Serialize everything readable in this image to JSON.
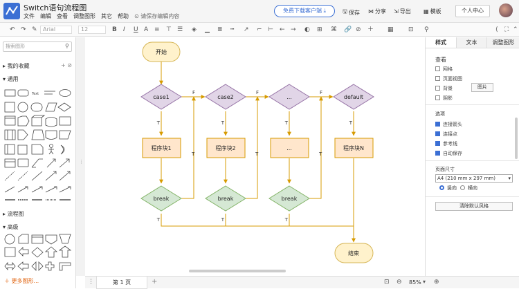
{
  "app": {
    "title": "Switch语句流程图",
    "menu": [
      "文件",
      "编辑",
      "查看",
      "调整图形",
      "其它",
      "帮助"
    ],
    "unsaved_notice": "请保存编辑内容",
    "download_btn": "免费下载客户端",
    "actions": [
      "保存",
      "分享",
      "导出",
      "模板"
    ],
    "personal_center": "个人中心"
  },
  "toolbar": {
    "font_family": "Arial",
    "font_size": "12"
  },
  "left_panel": {
    "search_placeholder": "搜索图形",
    "sections": [
      "我的收藏",
      "通用",
      "流程图",
      "高级"
    ],
    "more_shapes": "更多图形..."
  },
  "right_panel": {
    "tabs": [
      "样式",
      "文本",
      "调整图形"
    ],
    "view_title": "查看",
    "view_options": [
      {
        "label": "网格",
        "checked": false
      },
      {
        "label": "页面视图",
        "checked": false
      },
      {
        "label": "背景",
        "checked": false
      },
      {
        "label": "阴影",
        "checked": false
      }
    ],
    "image_btn": "图片",
    "options_title": "选项",
    "options": [
      {
        "label": "连接箭头",
        "checked": true
      },
      {
        "label": "连接点",
        "checked": true
      },
      {
        "label": "参考线",
        "checked": true
      },
      {
        "label": "自动保存",
        "checked": true
      }
    ],
    "page_size_title": "页面尺寸",
    "page_size_value": "A4 (210 mm x 297 mm)",
    "orientation": [
      "竖向",
      "横向"
    ],
    "reset_btn": "清除默认风格"
  },
  "diagram": {
    "start": "开始",
    "end": "结束",
    "cases": [
      "case1",
      "case2",
      "...",
      "default"
    ],
    "blocks": [
      "程序块1",
      "程序块2",
      "...",
      "程序块N"
    ],
    "break_label": "break",
    "true_label": "T",
    "false_label": "F"
  },
  "bottom": {
    "page_tab": "第 1 页",
    "zoom": "85%"
  },
  "colors": {
    "accent": "#3b6fd4",
    "terminal_fill": "#fff2cc",
    "terminal_stroke": "#d6b656",
    "decision_fill": "#e1d5e7",
    "decision_stroke": "#9673a6",
    "process_fill": "#ffe6cc",
    "process_stroke": "#d79b00",
    "break_fill": "#d5e8d4",
    "break_stroke": "#82b366",
    "edge": "#d79b00"
  }
}
